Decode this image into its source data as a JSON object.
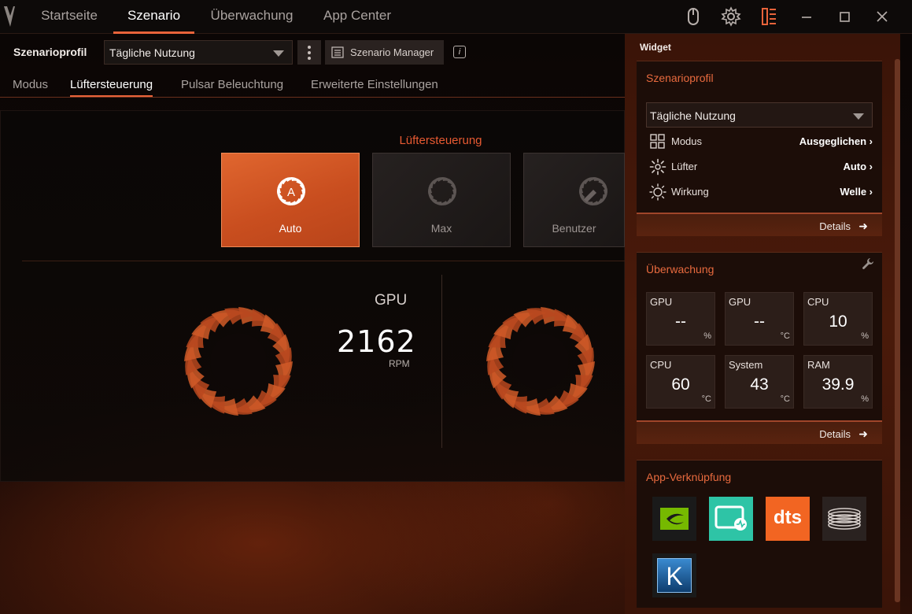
{
  "nav": {
    "tabs": [
      {
        "label": "Startseite"
      },
      {
        "label": "Szenario"
      },
      {
        "label": "Überwachung"
      },
      {
        "label": "App Center"
      }
    ]
  },
  "profile": {
    "label": "Szenarioprofil",
    "selected": "Tägliche Nutzung",
    "manager_label": "Szenario Manager"
  },
  "subtabs": [
    {
      "label": "Modus"
    },
    {
      "label": "Lüftersteuerung"
    },
    {
      "label": "Pulsar Beleuchtung"
    },
    {
      "label": "Erweiterte Einstellungen"
    }
  ],
  "fan_control": {
    "title": "Lüftersteuerung",
    "modes": [
      {
        "label": "Auto",
        "active": true
      },
      {
        "label": "Max",
        "active": false
      },
      {
        "label": "Benutzer",
        "active": false
      }
    ],
    "gpu": {
      "label": "GPU",
      "rpm": "2162",
      "unit": "RPM"
    }
  },
  "widget": {
    "title": "Widget",
    "profile_card": {
      "heading": "Szenarioprofil",
      "selected": "Tägliche Nutzung",
      "rows": [
        {
          "name": "Modus",
          "value": "Ausgeglichen",
          "icon": "grid-icon"
        },
        {
          "name": "Lüfter",
          "value": "Auto",
          "icon": "fan-icon"
        },
        {
          "name": "Wirkung",
          "value": "Welle",
          "icon": "sun-icon"
        }
      ],
      "details": "Details"
    },
    "monitor_card": {
      "heading": "Überwachung",
      "tiles": [
        {
          "label": "GPU",
          "value": "--",
          "unit": "%"
        },
        {
          "label": "GPU",
          "value": "--",
          "unit": "°C"
        },
        {
          "label": "CPU",
          "value": "10",
          "unit": "%"
        },
        {
          "label": "CPU",
          "value": "60",
          "unit": "°C"
        },
        {
          "label": "System",
          "value": "43",
          "unit": "°C"
        },
        {
          "label": "RAM",
          "value": "39.9",
          "unit": "%"
        }
      ],
      "details": "Details"
    },
    "apps_card": {
      "heading": "App-Verknüpfung",
      "apps": [
        {
          "icon": "nvidia-icon"
        },
        {
          "icon": "monitor-app-icon"
        },
        {
          "icon": "dts-icon",
          "text": "dts"
        },
        {
          "icon": "coil-app-icon"
        },
        {
          "icon": "killer-icon",
          "text": "K"
        }
      ]
    }
  },
  "colors": {
    "accent": "#e8633a",
    "active_card": "#d85a28",
    "widget_bg": "#3a1408"
  }
}
